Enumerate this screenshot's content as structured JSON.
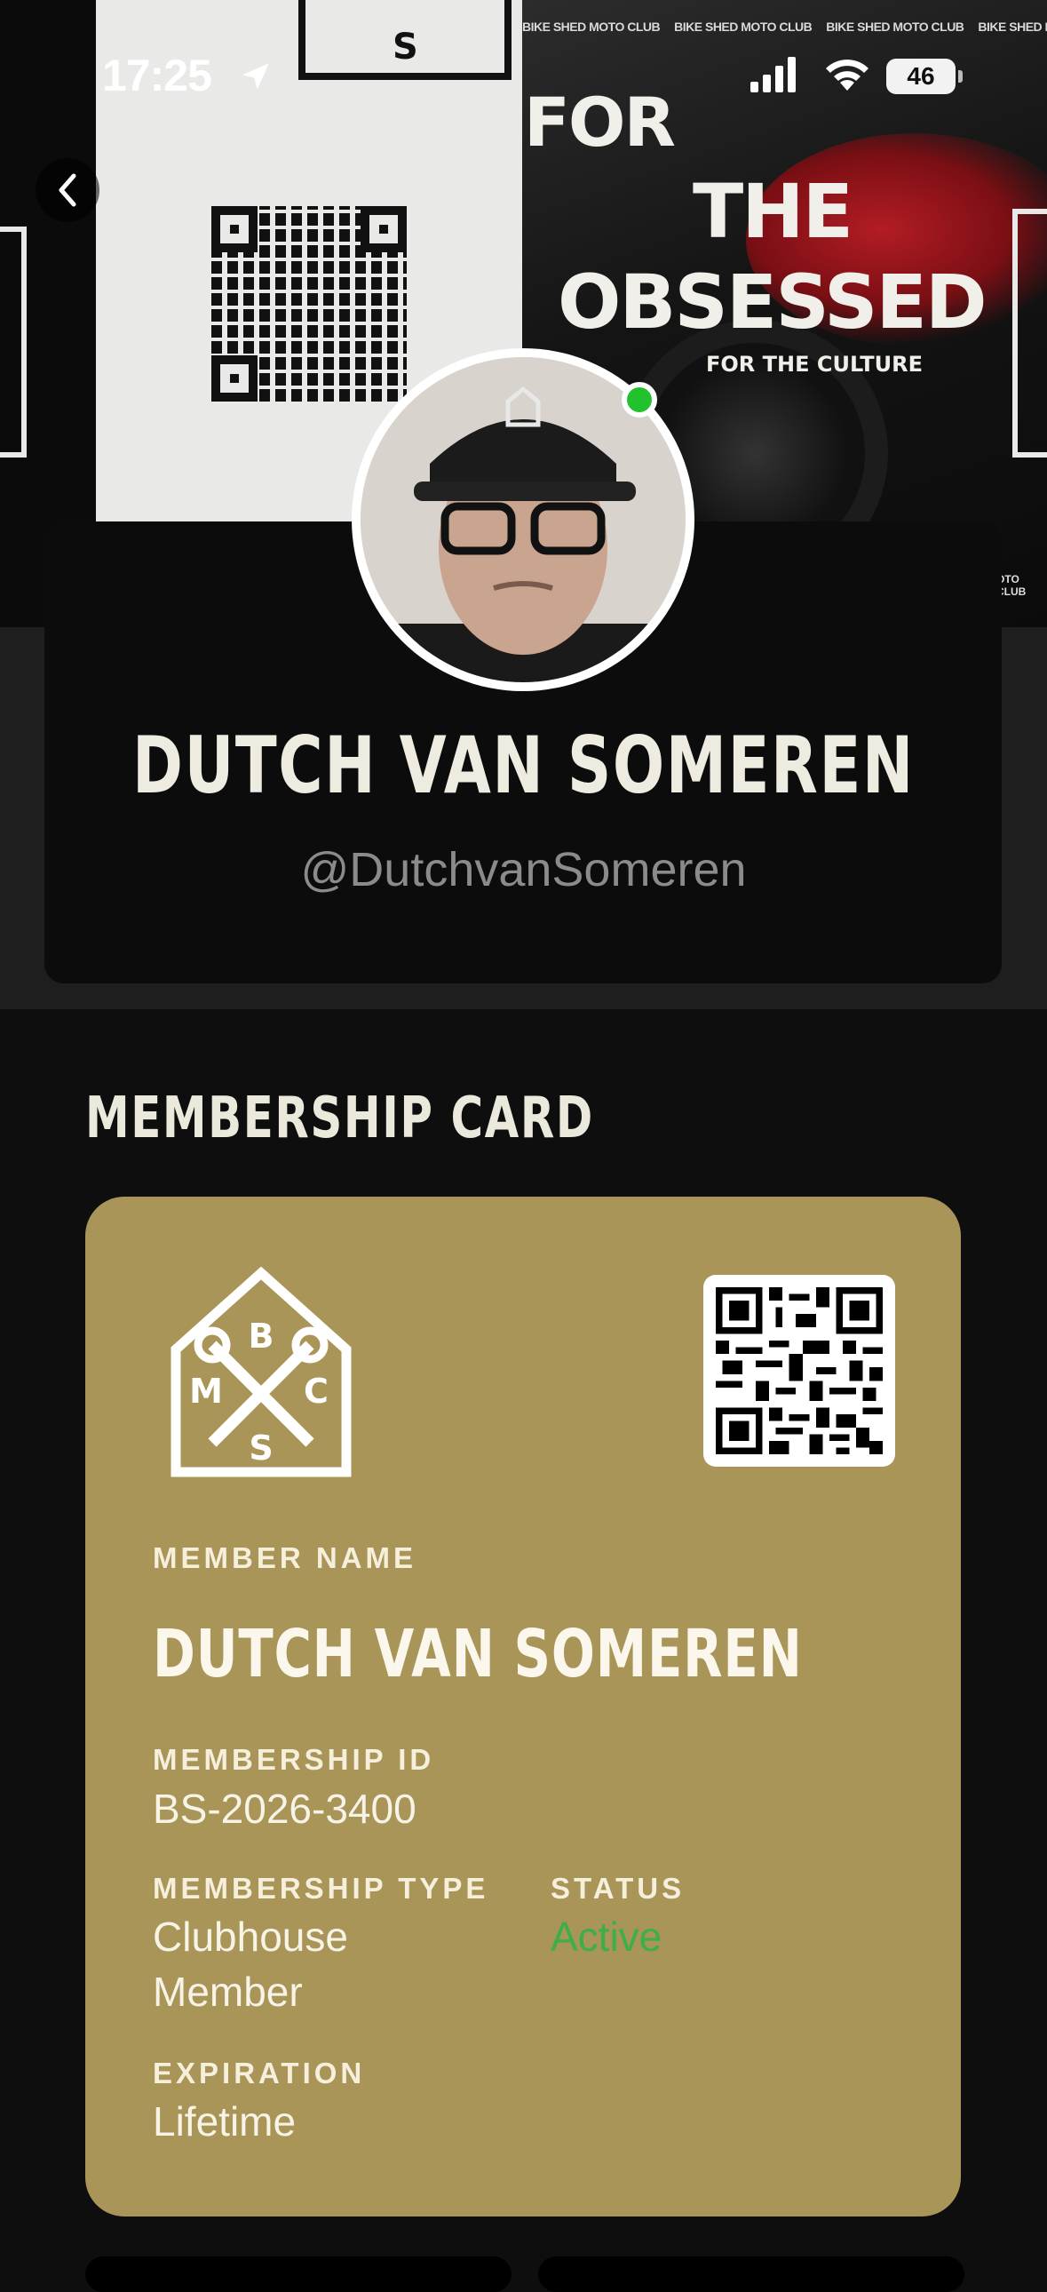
{
  "status_bar": {
    "time": "17:25",
    "battery": "46",
    "icons": [
      "location-arrow-icon",
      "cellular-signal-icon",
      "wifi-icon",
      "battery-icon"
    ]
  },
  "hero": {
    "strip_text": "BIKE SHED MOTO CLUB",
    "slogan_line1": "FOR",
    "slogan_line2": "THE",
    "slogan_line3": "OBSESSED",
    "slogan_line4": "FOR THE CULTURE",
    "corner_text": "OTO CLUB",
    "logo_letter": "S"
  },
  "profile": {
    "name": "DUTCH VAN SOMEREN",
    "handle": "@DutchvanSomeren",
    "online": true
  },
  "membership": {
    "section_title": "MEMBERSHIP CARD",
    "card_color": "#a89557",
    "logo_letters": [
      "B",
      "M",
      "C",
      "S"
    ],
    "member_name_label": "MEMBER NAME",
    "member_name": "DUTCH VAN SOMEREN",
    "membership_id_label": "MEMBERSHIP ID",
    "membership_id": "BS-2026-3400",
    "membership_type_label": "MEMBERSHIP TYPE",
    "membership_type_line1": "Clubhouse",
    "membership_type_line2": "Member",
    "status_label": "STATUS",
    "status": "Active",
    "status_color": "#3cae4a",
    "expiration_label": "EXPIRATION",
    "expiration": "Lifetime"
  }
}
